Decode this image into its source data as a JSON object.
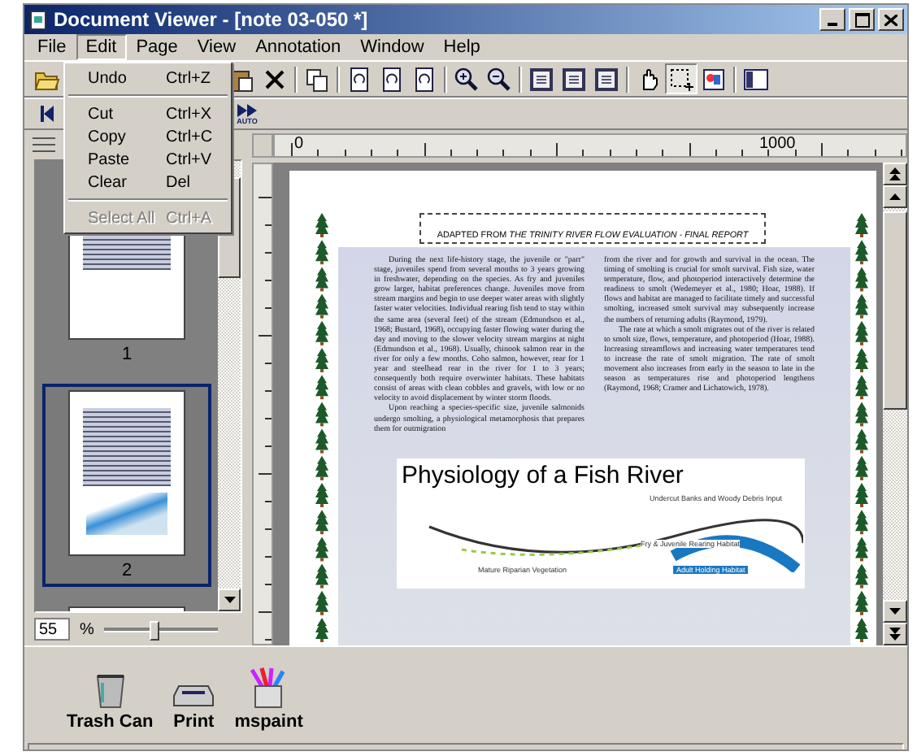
{
  "title_bar": {
    "title": "Document Viewer - [note 03-050 *]"
  },
  "menubar": [
    {
      "label": "File",
      "selected": false
    },
    {
      "label": "Edit",
      "selected": true
    },
    {
      "label": "Page",
      "selected": false
    },
    {
      "label": "View",
      "selected": false
    },
    {
      "label": "Annotation",
      "selected": false
    },
    {
      "label": "Window",
      "selected": false
    },
    {
      "label": "Help",
      "selected": false
    }
  ],
  "edit_menu": [
    {
      "kind": "item",
      "label": "Undo",
      "shortcut": "Ctrl+Z",
      "disabled": false
    },
    {
      "kind": "separator"
    },
    {
      "kind": "item",
      "label": "Cut",
      "shortcut": "Ctrl+X",
      "disabled": false
    },
    {
      "kind": "item",
      "label": "Copy",
      "shortcut": "Ctrl+C",
      "disabled": false
    },
    {
      "kind": "item",
      "label": "Paste",
      "shortcut": "Ctrl+V",
      "disabled": false
    },
    {
      "kind": "item",
      "label": "Clear",
      "shortcut": "Del",
      "disabled": false
    },
    {
      "kind": "separator"
    },
    {
      "kind": "item",
      "label": "Select All",
      "shortcut": "Ctrl+A",
      "disabled": true
    }
  ],
  "toolbar2": {
    "auto_label": "AUTO"
  },
  "thumbnails": {
    "pages": [
      {
        "label": "1",
        "selected": false
      },
      {
        "label": "2",
        "selected": true
      },
      {
        "selected": false
      }
    ],
    "zoom_value": "55",
    "zoom_unit": "%",
    "zoom_slider": {
      "level": 0.45
    }
  },
  "ruler": {
    "start_label": "0",
    "mark_label": "1000"
  },
  "document": {
    "header": "ADAPTED FROM *THE TRINITY RIVER FLOW EVALUATION - FINAL REPORT*",
    "columns": [
      [
        "During the next life-history stage, the juvenile or \"parr\" stage, juveniles spend from several months to 3 years growing in freshwater, depending on the species. As fry and juveniles grow larger, habitat preferences change. Juveniles move from stream margins and begin to use deeper water areas with slightly faster water velocities. Individual rearing fish tend to stay within the same area (several feet) of the stream (Edmundson et al., 1968; Bustard, 1968), occupying faster flowing water during the day and moving to the slower velocity stream margins at night (Edmundson et al., 1968). Usually, chinook salmon rear in the river for only a few months. Coho salmon, however, rear for 1 year and steelhead rear in the river for 1 to 3 years; consequently both require overwinter habitats. These habitats consist of areas with clean cobbles and gravels, with low or no velocity to avoid displacement by winter storm floods.",
        "Upon reaching a species-specific size, juvenile salmonids undergo smolting, a physiological metamorphosis that prepares them for outmigration"
      ],
      [
        "from the river and for growth and survival in the ocean. The timing of smolting is crucial for smolt survival. Fish size, water temperature, flow, and photoperiod interactively determine the readiness to smolt (Wedemeyer et al., 1980; Hoar, 1988). If flows and habitat are managed to facilitate timely and successful smolting, increased smolt survival may subsequently increase the numbers of returning adults (Raymond, 1979).",
        "The rate at which a smolt migrates out of the river is related to smolt size, flows, temperature, and photoperiod (Hoar, 1988). Increasing streamflows and increasing water temperatures tend to increase the rate of smolt migration. The rate of smolt movement also increases from early in the season to late in the season as temperatures rise and photoperiod lengthens (Raymond, 1968; Cramer and Lichatowich, 1978)."
      ]
    ],
    "figure": {
      "title": "Physiology of a Fish River",
      "labels": [
        "Undercut Banks and Woody Debris Input",
        "Fry & Juvenile Rearing Habitat",
        "Mature Riparian Vegetation",
        "Adult Holding Habitat"
      ]
    }
  },
  "desktop_icons": [
    {
      "kind": "trash",
      "label": "Trash Can"
    },
    {
      "kind": "print",
      "label": "Print"
    },
    {
      "kind": "paint",
      "label": "mspaint"
    }
  ]
}
